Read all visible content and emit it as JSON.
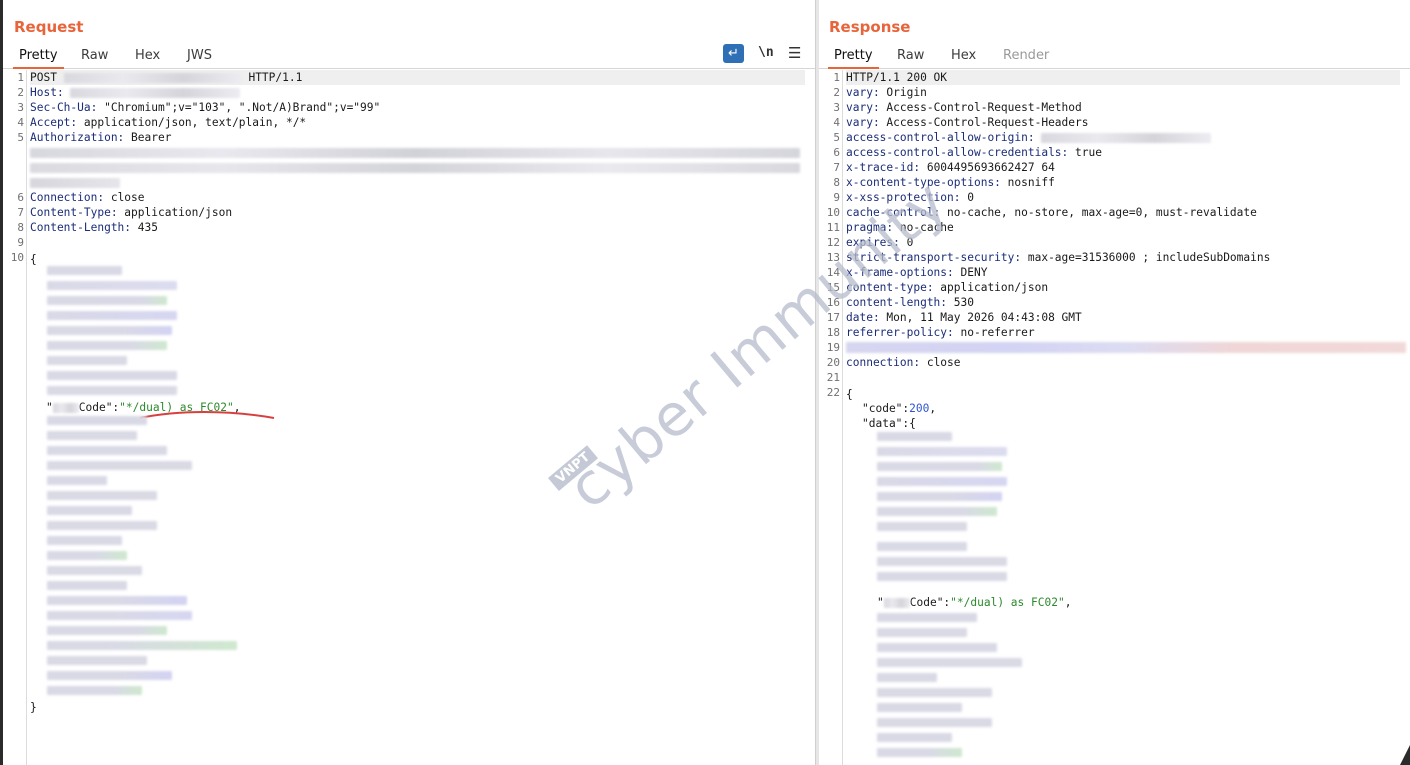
{
  "request": {
    "title": "Request",
    "tabs": [
      "Pretty",
      "Raw",
      "Hex",
      "JWS"
    ],
    "active_tab": "Pretty",
    "tools": {
      "wrap_icon": "↵",
      "newline_toggle": "\\n",
      "menu_icon": "☰"
    },
    "lines": {
      "l1_method": "POST",
      "l1_proto": "HTTP/1.1",
      "l2_key": "Host:",
      "l3_key": "Sec-Ch-Ua:",
      "l3_val": " \"Chromium\";v=\"103\", \".Not/A)Brand\";v=\"99\"",
      "l4_key": "Accept:",
      "l4_val": " application/json, text/plain, */*",
      "l5_key": "Authorization:",
      "l5_val": " Bearer",
      "l6_key": "Connection:",
      "l6_val": " close",
      "l7_key": "Content-Type:",
      "l7_val": " application/json",
      "l8_key": "Content-Length:",
      "l8_val": " 435",
      "l10_open": "{",
      "code_key_tail": "Code\":",
      "code_val": "\"*/dual) as FC02\"",
      "code_comma": ",",
      "close": "}"
    }
  },
  "response": {
    "title": "Response",
    "tabs": [
      "Pretty",
      "Raw",
      "Hex",
      "Render"
    ],
    "active_tab": "Pretty",
    "headers": [
      {
        "k": "HTTP/1.1 200 OK",
        "v": ""
      },
      {
        "k": "vary:",
        "v": " Origin"
      },
      {
        "k": "vary:",
        "v": " Access-Control-Request-Method"
      },
      {
        "k": "vary:",
        "v": " Access-Control-Request-Headers"
      },
      {
        "k": "access-control-allow-origin:",
        "v": ""
      },
      {
        "k": "access-control-allow-credentials:",
        "v": " true"
      },
      {
        "k": "x-trace-id:",
        "v": " 6004495693662427 64"
      },
      {
        "k": "x-content-type-options:",
        "v": " nosniff"
      },
      {
        "k": "x-xss-protection:",
        "v": " 0"
      },
      {
        "k": "cache-control:",
        "v": " no-cache, no-store, max-age=0, must-revalidate"
      },
      {
        "k": "pragma:",
        "v": " no-cache"
      },
      {
        "k": "expires:",
        "v": " 0"
      },
      {
        "k": "strict-transport-security:",
        "v": " max-age=31536000 ; includeSubDomains"
      },
      {
        "k": "x-frame-options:",
        "v": " DENY"
      },
      {
        "k": "content-type:",
        "v": " application/json"
      },
      {
        "k": "content-length:",
        "v": " 530"
      },
      {
        "k": "date:",
        "v": " Mon, 11 May 2026 04:43:08 GMT"
      },
      {
        "k": "referrer-policy:",
        "v": " no-referrer"
      }
    ],
    "connection_key": "connection:",
    "connection_val": " close",
    "body_open": "{",
    "code_key": "\"code\":",
    "code_val": "200",
    "code_comma": ",",
    "data_key": "\"data\":{",
    "resp_code_key_tail": "Code\":",
    "resp_code_val": "\"*/dual) as FC02\"",
    "resp_code_comma": ","
  },
  "watermark": {
    "badge": "VNPT",
    "text": "cyber Immunity"
  },
  "colors": {
    "accent": "#e8643a",
    "key": "#1b2d78",
    "string": "#2c8a2c",
    "number": "#2f56d0",
    "wrap_button": "#2f6fb6"
  }
}
